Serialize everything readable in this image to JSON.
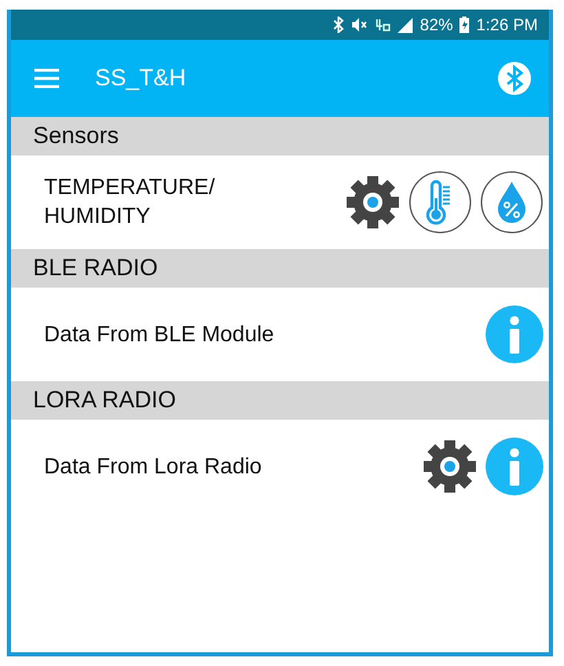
{
  "status_bar": {
    "battery": "82%",
    "time": "1:26 PM"
  },
  "app_bar": {
    "title": "SS_T&H"
  },
  "sections": [
    {
      "title": "Sensors",
      "items": [
        {
          "label": "TEMPERATURE/\nHUMIDITY",
          "actions": [
            {
              "kind": "settings"
            },
            {
              "kind": "thermometer"
            },
            {
              "kind": "humidity"
            }
          ]
        }
      ]
    },
    {
      "title": "BLE RADIO",
      "items": [
        {
          "label": "Data From BLE Module",
          "actions": [
            {
              "kind": "info"
            }
          ]
        }
      ]
    },
    {
      "title": "LORA RADIO",
      "items": [
        {
          "label": "Data From Lora Radio",
          "actions": [
            {
              "kind": "settings"
            },
            {
              "kind": "info"
            }
          ]
        }
      ]
    }
  ]
}
